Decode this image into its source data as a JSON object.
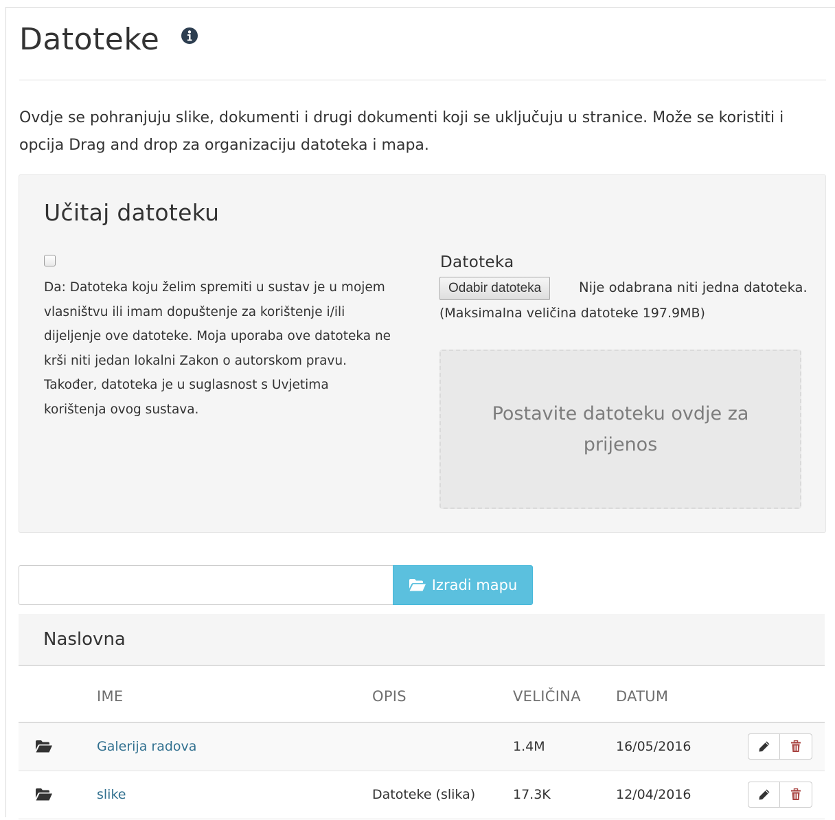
{
  "page": {
    "title": "Datoteke",
    "info_icon": "info-circle-icon",
    "intro": "Ovdje se pohranjuju slike, dokumenti i drugi dokumenti koji se uključuju u stranice. Može se koristiti i opcija Drag and drop za organizaciju datoteka i mapa."
  },
  "upload": {
    "title": "Učitaj datoteku",
    "consent_checked": false,
    "consent_text": "Da: Datoteka koju želim spremiti u sustav je u mojem vlasništvu ili imam dopuštenje za korištenje i/ili dijeljenje ove datoteke. Moja uporaba ove datoteka ne krši niti jedan lokalni Zakon o autorskom pravu. Također, datoteka je u suglasnost s Uvjetima korištenja ovog sustava.",
    "file_label": "Datoteka",
    "file_button": "Odabir datoteka",
    "file_status": "Nije odabrana niti jedna datoteka.",
    "max_size": "(Maksimalna veličina datoteke 197.9MB)",
    "dropzone_text": "Postavite datoteku ovdje za prijenos"
  },
  "folder_create": {
    "input_value": "",
    "button_label": "Izradi mapu",
    "button_icon": "folder-open-icon"
  },
  "colors": {
    "info_button": "#5bc0de",
    "link": "#31708f",
    "delete": "#a94442"
  },
  "files": {
    "heading": "Naslovna",
    "columns": {
      "name": "IME",
      "description": "OPIS",
      "size": "VELIČINA",
      "date": "DATUM"
    },
    "rows": [
      {
        "icon": "folder-icon",
        "name": "Galerija radova",
        "description": "",
        "size": "1.4M",
        "date": "16/05/2016"
      },
      {
        "icon": "folder-icon",
        "name": "slike",
        "description": "Datoteke (slika)",
        "size": "17.3K",
        "date": "12/04/2016"
      }
    ],
    "row_actions": {
      "edit_icon": "pencil-icon",
      "delete_icon": "trash-icon"
    }
  }
}
